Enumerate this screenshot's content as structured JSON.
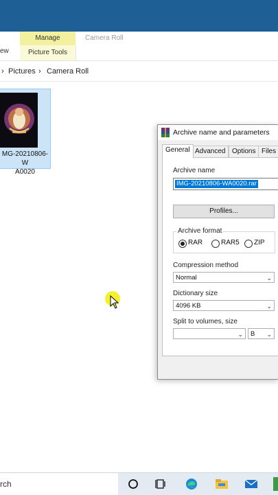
{
  "explorer": {
    "ribbon": {
      "manage_label": "Manage",
      "picture_tools_label": "Picture Tools",
      "view_tab_label": "ew",
      "window_title": "Camera Roll"
    },
    "breadcrumb": {
      "sep1": "›",
      "pictures": "Pictures",
      "sep2": "›",
      "camera_roll": "Camera Roll"
    },
    "file": {
      "name_line1": "MG-20210806-W",
      "name_line2": "A0020"
    }
  },
  "dialog": {
    "title": "Archive name and parameters",
    "tabs": [
      "General",
      "Advanced",
      "Options",
      "Files"
    ],
    "archive_name_label": "Archive name",
    "archive_name_value": "IMG-20210806-WA0020.rar",
    "profiles_button": "Profiles...",
    "archive_format_label": "Archive format",
    "formats": [
      {
        "label": "RAR",
        "selected": true
      },
      {
        "label": "RAR5",
        "selected": false
      },
      {
        "label": "ZIP",
        "selected": false
      }
    ],
    "compression_label": "Compression method",
    "compression_value": "Normal",
    "dictionary_label": "Dictionary size",
    "dictionary_value": "4096 KB",
    "split_label": "Split to volumes, size",
    "split_value": "",
    "split_unit": "B"
  },
  "taskbar": {
    "search_text": "rch",
    "icons": [
      "cortana-icon",
      "task-view-icon",
      "edge-icon",
      "file-explorer-icon",
      "mail-icon"
    ]
  },
  "colors": {
    "top_band": "#1e5f96",
    "manage_tab": "#f3f0a0",
    "selection": "#0078d7",
    "cursor_highlight": "#f4ee1a"
  }
}
